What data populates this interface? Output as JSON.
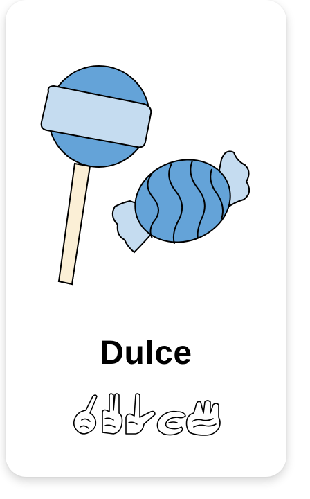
{
  "card": {
    "word": "Dulce",
    "illustration_icon": "lollipop-and-candy-illustration",
    "fingerspelling_icon": "fingerspelling-hands-icon"
  },
  "colors": {
    "card_background": "#ffffff",
    "candy_dark_blue": "#64a3d8",
    "candy_light_blue": "#c5dcf0",
    "stick_cream": "#fbefd6",
    "outline": "#000000"
  }
}
